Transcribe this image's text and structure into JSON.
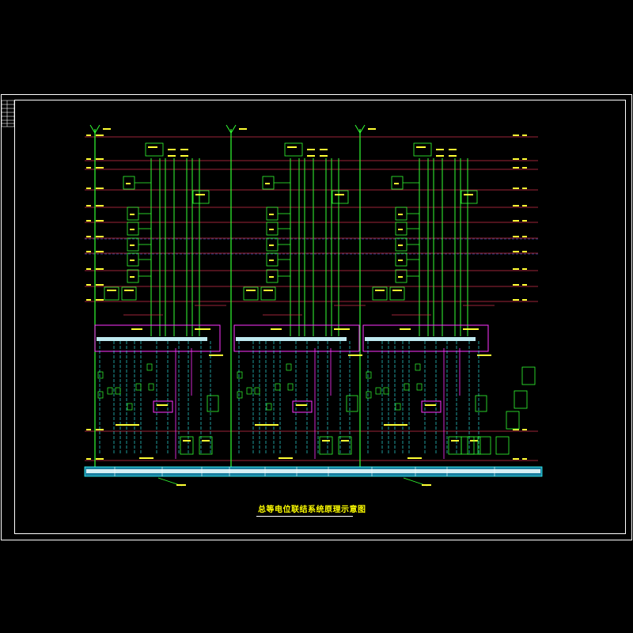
{
  "drawing": {
    "title": "总等电位联结系统原理示意图",
    "colors": {
      "background": "#000000",
      "frame": "#ffffff",
      "floor_line": "#d0304a",
      "riser": "#33ff33",
      "text": "#ffff33",
      "box": "#33ff33",
      "magenta": "#ff33ff",
      "cyan": "#33ffff",
      "busbar": "#bfe9f0"
    }
  }
}
